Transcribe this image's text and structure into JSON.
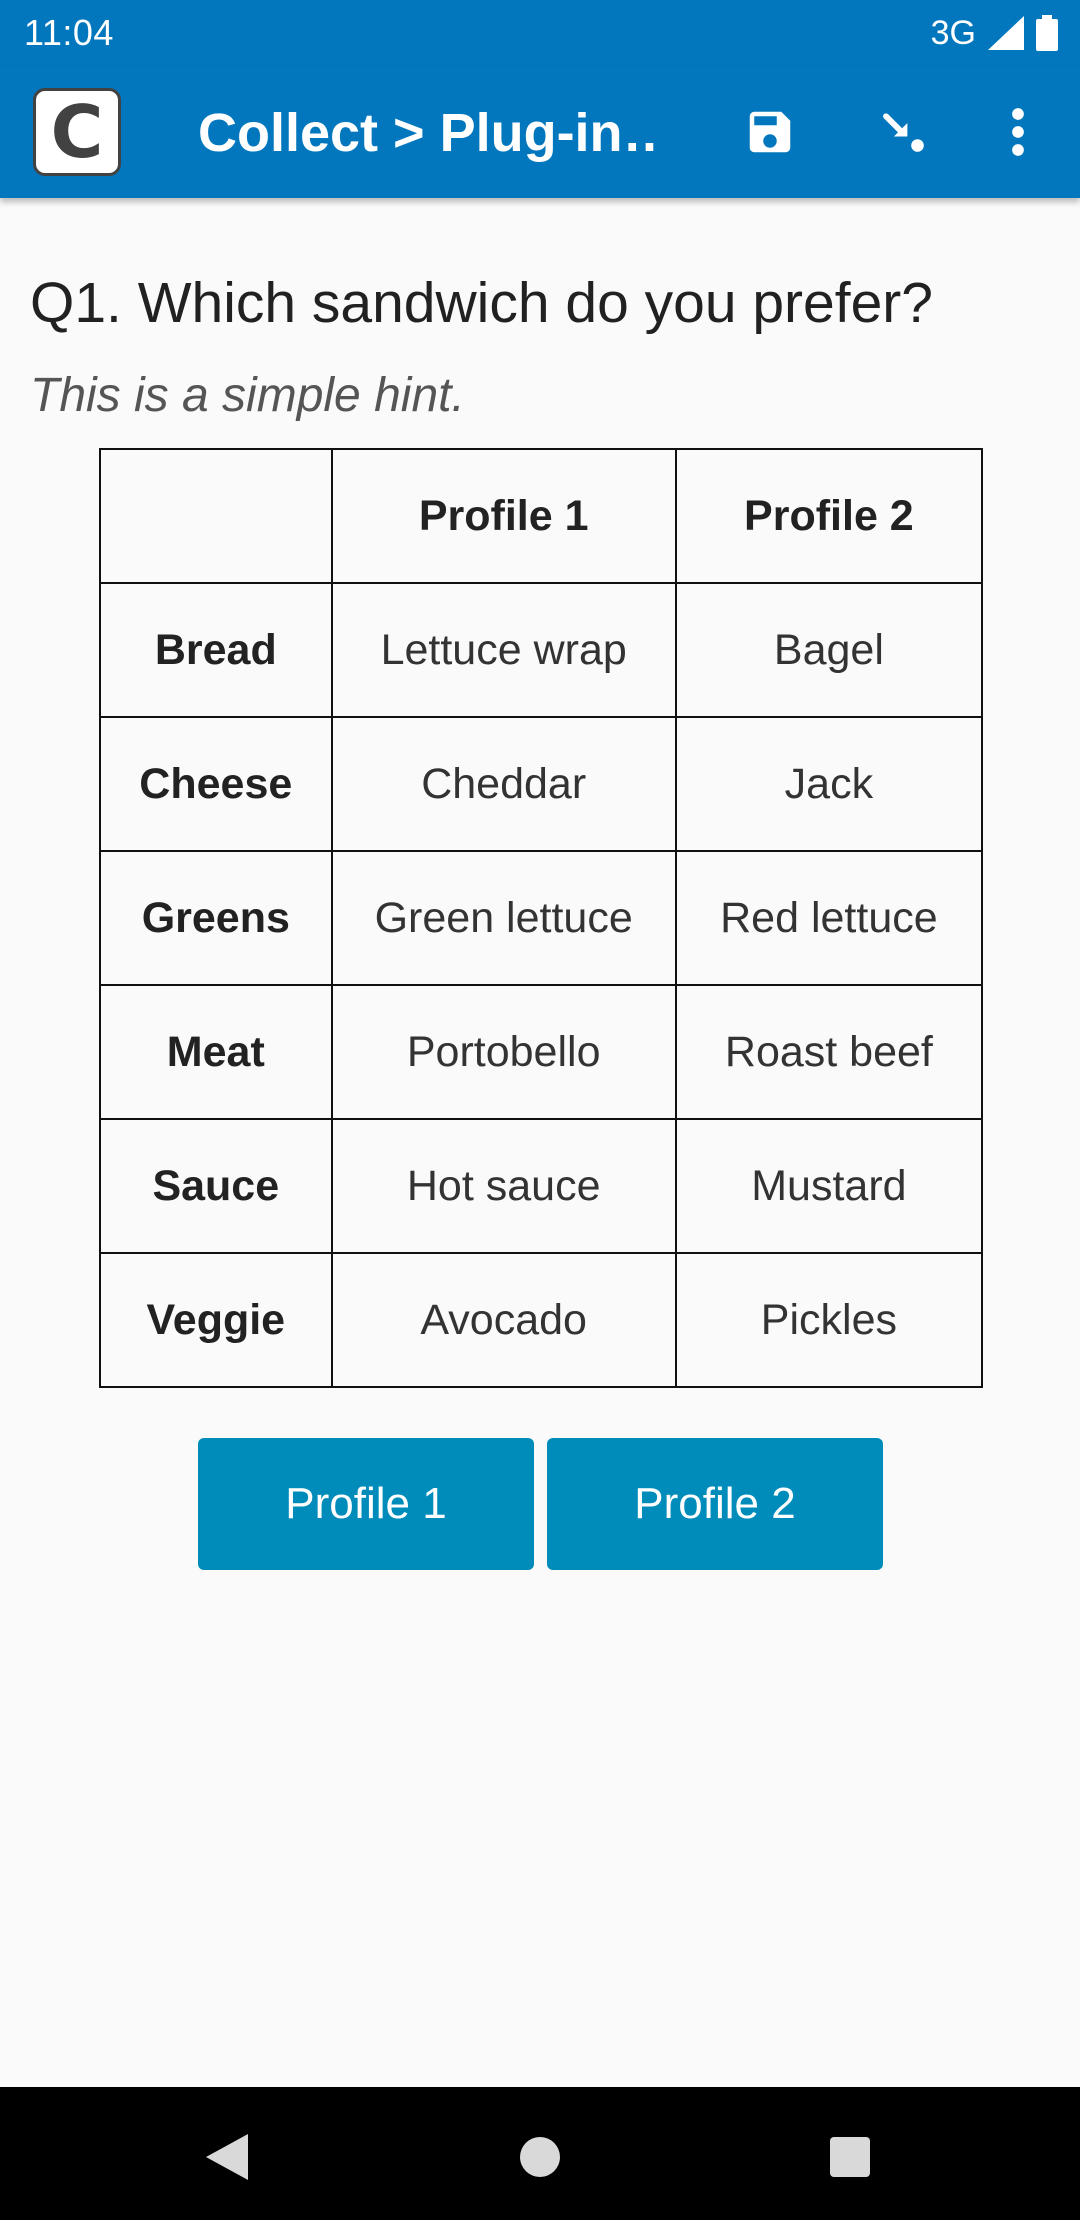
{
  "status_bar": {
    "time": "11:04",
    "network": "3G"
  },
  "app_bar": {
    "logo_letter": "C",
    "title": "Collect > Plug-in…",
    "icons": [
      "save-icon",
      "go-to-icon",
      "more-vert-icon"
    ]
  },
  "question": {
    "label": "Q1. Which sandwich do you prefer?",
    "hint": "This is a simple hint."
  },
  "table": {
    "headers": [
      "",
      "Profile 1",
      "Profile 2"
    ],
    "rows": [
      {
        "attribute": "Bread",
        "p1": "Lettuce wrap",
        "p2": "Bagel"
      },
      {
        "attribute": "Cheese",
        "p1": "Cheddar",
        "p2": "Jack"
      },
      {
        "attribute": "Greens",
        "p1": "Green lettuce",
        "p2": "Red lettuce"
      },
      {
        "attribute": "Meat",
        "p1": "Portobello",
        "p2": "Roast beef"
      },
      {
        "attribute": "Sauce",
        "p1": "Hot sauce",
        "p2": "Mustard"
      },
      {
        "attribute": "Veggie",
        "p1": "Avocado",
        "p2": "Pickles"
      }
    ]
  },
  "buttons": {
    "profile1": "Profile 1",
    "profile2": "Profile 2"
  },
  "colors": {
    "app_bar": "#0277bd",
    "button": "#008cba",
    "background": "#fafafa"
  }
}
